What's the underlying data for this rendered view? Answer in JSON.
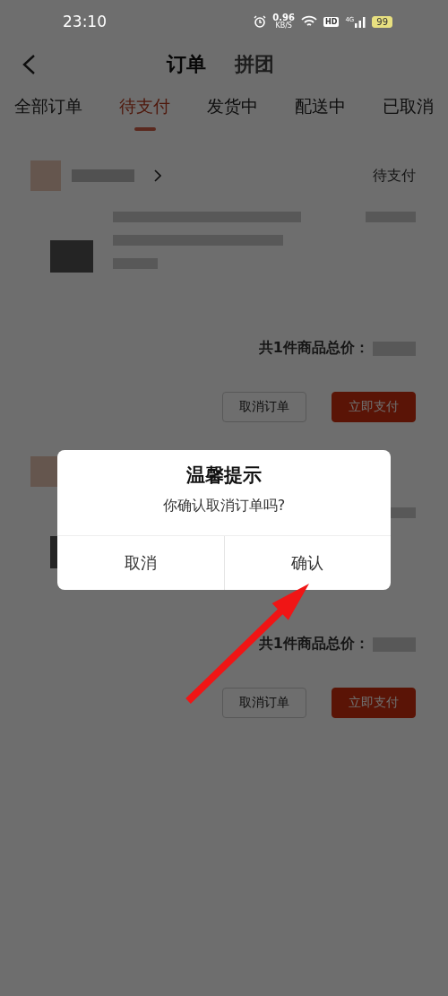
{
  "status_bar": {
    "time": "23:10",
    "net_speed": "0.96",
    "net_speed_unit": "KB/S",
    "hd_badge": "HD",
    "network": "4G",
    "battery": "99"
  },
  "header": {
    "tabs": [
      {
        "label": "订单",
        "selected": true
      },
      {
        "label": "拼团",
        "selected": false
      }
    ]
  },
  "filter_tabs": [
    {
      "label": "全部订单",
      "selected": false
    },
    {
      "label": "待支付",
      "selected": true
    },
    {
      "label": "发货中",
      "selected": false
    },
    {
      "label": "配送中",
      "selected": false
    },
    {
      "label": "已取消",
      "selected": false
    }
  ],
  "orders": [
    {
      "status": "待支付",
      "total_label": "共1件商品总价：",
      "buttons": [
        {
          "label": "取消订单",
          "kind": "secondary"
        },
        {
          "label": "立即支付",
          "kind": "primary"
        }
      ]
    },
    {
      "total_label": "共1件商品总价：",
      "buttons": [
        {
          "label": "取消订单",
          "kind": "secondary"
        },
        {
          "label": "立即支付",
          "kind": "primary"
        }
      ]
    }
  ],
  "dialog": {
    "title": "温馨提示",
    "message": "你确认取消订单吗?",
    "buttons": [
      {
        "label": "取消"
      },
      {
        "label": "确认"
      }
    ]
  }
}
